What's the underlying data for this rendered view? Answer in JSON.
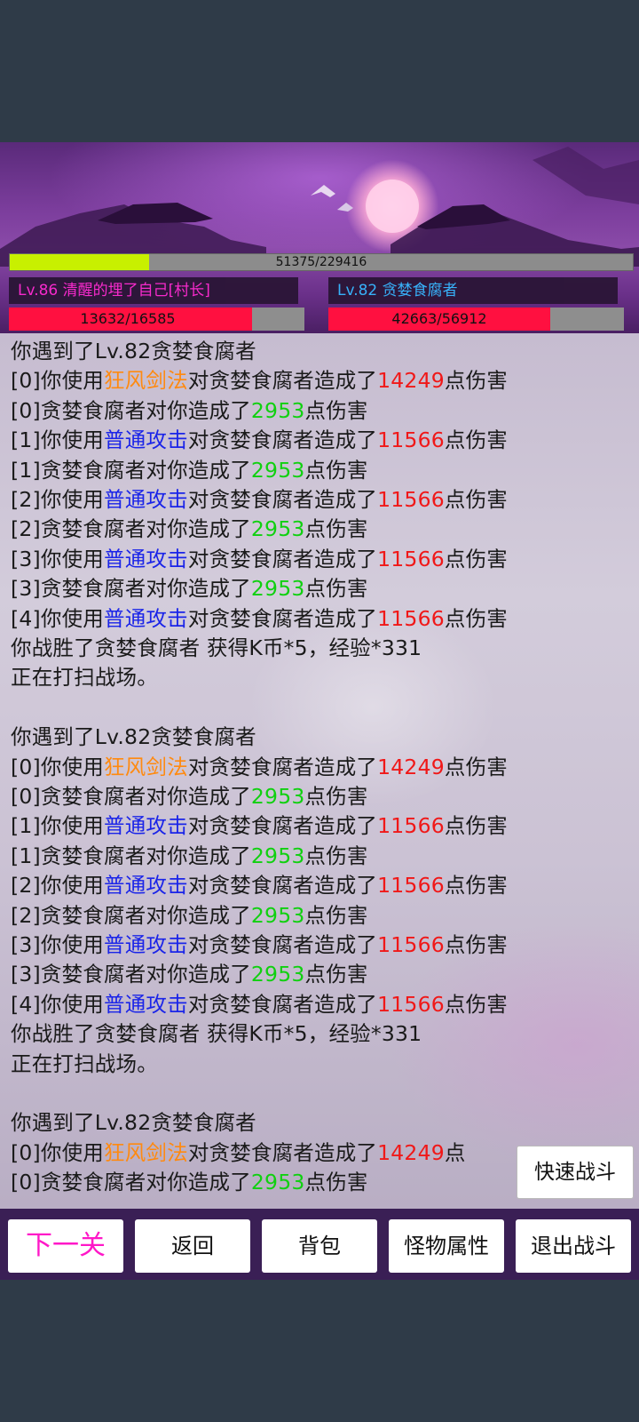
{
  "player": {
    "name_label": "Lv.86 清醒的埋了自己[村长]",
    "exp_text": "51375/229416",
    "exp_fraction": 0.224,
    "hp_text": "13632/16585",
    "hp_fraction": 0.822
  },
  "enemy": {
    "name_label": "Lv.82 贪婪食腐者",
    "hp_text": "42663/56912",
    "hp_fraction": 0.75
  },
  "colors": {
    "skill": "#ff8a10",
    "normal_attack": "#1a24e8",
    "damage_dealt": "#f01818",
    "damage_taken": "#10d010",
    "hp": "#ff1040",
    "exp": "#c8f000"
  },
  "log": {
    "encounter": "你遇到了Lv.82贪婪食腐者",
    "lines": [
      {
        "parts": [
          {
            "t": "你遇到了Lv.82贪婪食腐者"
          }
        ]
      },
      {
        "parts": [
          {
            "t": "[0]你使用"
          },
          {
            "t": "狂风剑法",
            "c": "skill"
          },
          {
            "t": "对贪婪食腐者造成了"
          },
          {
            "t": "14249",
            "c": "dmg"
          },
          {
            "t": "点伤害"
          }
        ]
      },
      {
        "parts": [
          {
            "t": "[0]贪婪食腐者对你造成了"
          },
          {
            "t": "2953",
            "c": "taken"
          },
          {
            "t": "点伤害"
          }
        ]
      },
      {
        "parts": [
          {
            "t": "[1]你使用"
          },
          {
            "t": "普通攻击",
            "c": "normal"
          },
          {
            "t": "对贪婪食腐者造成了"
          },
          {
            "t": "11566",
            "c": "dmg"
          },
          {
            "t": "点伤害"
          }
        ]
      },
      {
        "parts": [
          {
            "t": "[1]贪婪食腐者对你造成了"
          },
          {
            "t": "2953",
            "c": "taken"
          },
          {
            "t": "点伤害"
          }
        ]
      },
      {
        "parts": [
          {
            "t": "[2]你使用"
          },
          {
            "t": "普通攻击",
            "c": "normal"
          },
          {
            "t": "对贪婪食腐者造成了"
          },
          {
            "t": "11566",
            "c": "dmg"
          },
          {
            "t": "点伤害"
          }
        ]
      },
      {
        "parts": [
          {
            "t": "[2]贪婪食腐者对你造成了"
          },
          {
            "t": "2953",
            "c": "taken"
          },
          {
            "t": "点伤害"
          }
        ]
      },
      {
        "parts": [
          {
            "t": "[3]你使用"
          },
          {
            "t": "普通攻击",
            "c": "normal"
          },
          {
            "t": "对贪婪食腐者造成了"
          },
          {
            "t": "11566",
            "c": "dmg"
          },
          {
            "t": "点伤害"
          }
        ]
      },
      {
        "parts": [
          {
            "t": "[3]贪婪食腐者对你造成了"
          },
          {
            "t": "2953",
            "c": "taken"
          },
          {
            "t": "点伤害"
          }
        ]
      },
      {
        "parts": [
          {
            "t": "[4]你使用"
          },
          {
            "t": "普通攻击",
            "c": "normal"
          },
          {
            "t": "对贪婪食腐者造成了"
          },
          {
            "t": "11566",
            "c": "dmg"
          },
          {
            "t": "点伤害"
          }
        ]
      },
      {
        "parts": [
          {
            "t": "你战胜了贪婪食腐者 获得K币*5，经验*331"
          }
        ]
      },
      {
        "parts": [
          {
            "t": "正在打扫战场。"
          }
        ]
      },
      {
        "parts": []
      },
      {
        "parts": [
          {
            "t": "你遇到了Lv.82贪婪食腐者"
          }
        ]
      },
      {
        "parts": [
          {
            "t": "[0]你使用"
          },
          {
            "t": "狂风剑法",
            "c": "skill"
          },
          {
            "t": "对贪婪食腐者造成了"
          },
          {
            "t": "14249",
            "c": "dmg"
          },
          {
            "t": "点伤害"
          }
        ]
      },
      {
        "parts": [
          {
            "t": "[0]贪婪食腐者对你造成了"
          },
          {
            "t": "2953",
            "c": "taken"
          },
          {
            "t": "点伤害"
          }
        ]
      },
      {
        "parts": [
          {
            "t": "[1]你使用"
          },
          {
            "t": "普通攻击",
            "c": "normal"
          },
          {
            "t": "对贪婪食腐者造成了"
          },
          {
            "t": "11566",
            "c": "dmg"
          },
          {
            "t": "点伤害"
          }
        ]
      },
      {
        "parts": [
          {
            "t": "[1]贪婪食腐者对你造成了"
          },
          {
            "t": "2953",
            "c": "taken"
          },
          {
            "t": "点伤害"
          }
        ]
      },
      {
        "parts": [
          {
            "t": "[2]你使用"
          },
          {
            "t": "普通攻击",
            "c": "normal"
          },
          {
            "t": "对贪婪食腐者造成了"
          },
          {
            "t": "11566",
            "c": "dmg"
          },
          {
            "t": "点伤害"
          }
        ]
      },
      {
        "parts": [
          {
            "t": "[2]贪婪食腐者对你造成了"
          },
          {
            "t": "2953",
            "c": "taken"
          },
          {
            "t": "点伤害"
          }
        ]
      },
      {
        "parts": [
          {
            "t": "[3]你使用"
          },
          {
            "t": "普通攻击",
            "c": "normal"
          },
          {
            "t": "对贪婪食腐者造成了"
          },
          {
            "t": "11566",
            "c": "dmg"
          },
          {
            "t": "点伤害"
          }
        ]
      },
      {
        "parts": [
          {
            "t": "[3]贪婪食腐者对你造成了"
          },
          {
            "t": "2953",
            "c": "taken"
          },
          {
            "t": "点伤害"
          }
        ]
      },
      {
        "parts": [
          {
            "t": "[4]你使用"
          },
          {
            "t": "普通攻击",
            "c": "normal"
          },
          {
            "t": "对贪婪食腐者造成了"
          },
          {
            "t": "11566",
            "c": "dmg"
          },
          {
            "t": "点伤害"
          }
        ]
      },
      {
        "parts": [
          {
            "t": "你战胜了贪婪食腐者 获得K币*5，经验*331"
          }
        ]
      },
      {
        "parts": [
          {
            "t": "正在打扫战场。"
          }
        ]
      },
      {
        "parts": []
      },
      {
        "parts": [
          {
            "t": "你遇到了Lv.82贪婪食腐者"
          }
        ]
      },
      {
        "parts": [
          {
            "t": "[0]你使用"
          },
          {
            "t": "狂风剑法",
            "c": "skill"
          },
          {
            "t": "对贪婪食腐者造成了"
          },
          {
            "t": "14249",
            "c": "dmg"
          },
          {
            "t": "点"
          }
        ]
      },
      {
        "parts": [
          {
            "t": "[0]贪婪食腐者对你造成了"
          },
          {
            "t": "2953",
            "c": "taken"
          },
          {
            "t": "点伤害"
          }
        ]
      }
    ]
  },
  "buttons": {
    "quick_battle": "快速战斗",
    "next_level": "下一关",
    "back": "返回",
    "bag": "背包",
    "monster_attr": "怪物属性",
    "exit_battle": "退出战斗"
  }
}
